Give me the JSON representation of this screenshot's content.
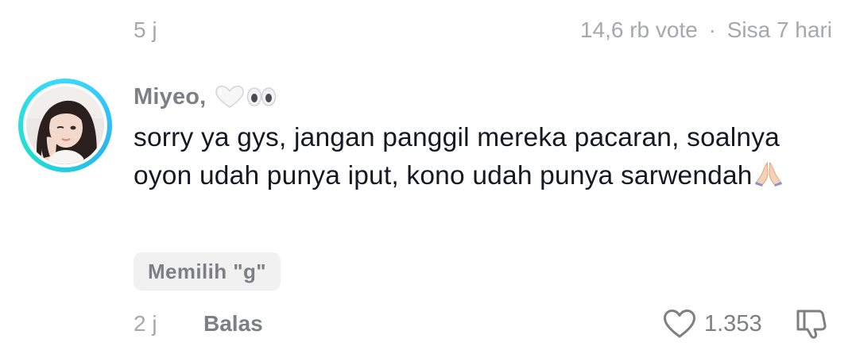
{
  "header": {
    "time": "5 j",
    "votes": "14,6 rb vote",
    "separator": "·",
    "remaining": "Sisa 7 hari"
  },
  "comment": {
    "username": "Miyeo,",
    "username_emoji": [
      "white-heart-icon",
      "eyes-icon"
    ],
    "text": "sorry ya gys, jangan panggil mereka pacaran, soalnya oyon udah punya iput, kono udah punya sarwendah",
    "text_emoji": "folded-hands-icon",
    "vote_choice": "Memilih \"g\"",
    "time": "2 j",
    "reply_label": "Balas",
    "like_count": "1.353"
  },
  "colors": {
    "ring_gradient": [
      "#3bd8ff",
      "#22e0d0"
    ],
    "muted_text": "#7d7f85",
    "light_text": "#a7a8ad",
    "body_text": "#161823",
    "pill_bg": "#f1f1f2"
  }
}
